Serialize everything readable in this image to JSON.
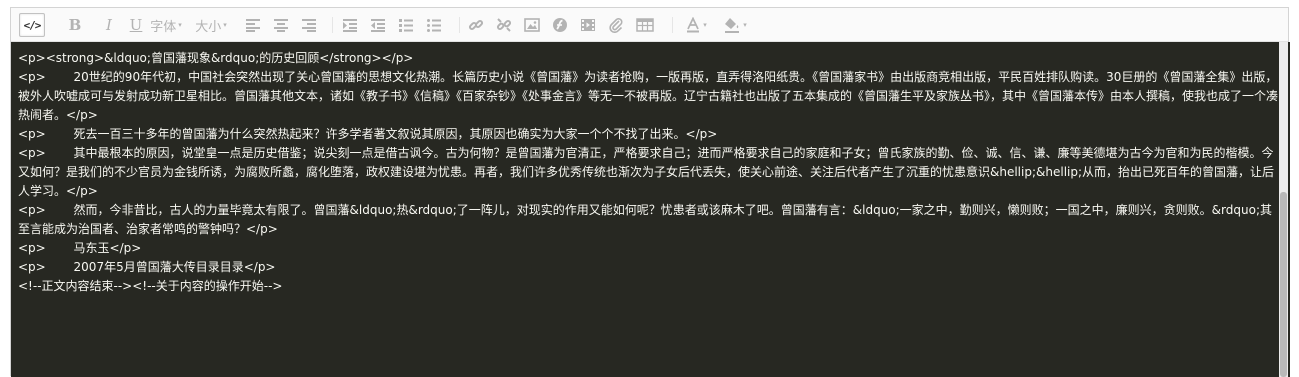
{
  "toolbar": {
    "source_label": "</>",
    "bold_label": "B",
    "italic_label": "I",
    "underline_label": "U",
    "font_family_label": "字体",
    "font_size_label": "大小",
    "caret": "▾",
    "buttons": [
      "code-view",
      "bold",
      "italic",
      "underline",
      "font-family",
      "font-size",
      "align-left",
      "align-center",
      "align-right",
      "indent",
      "outdent",
      "ordered-list",
      "unordered-list",
      "link",
      "unlink",
      "image",
      "flash",
      "video",
      "attachment",
      "table",
      "font-color",
      "background-color"
    ]
  },
  "editor": {
    "lines": [
      "<p><strong>&ldquo;曾国藩现象&rdquo;的历史回顾</strong></p>",
      "<p>　　 20世纪的90年代初，中国社会突然出现了关心曾国藩的思想文化热潮。长篇历史小说《曾国藩》为读者抢购，一版再版，直弄得洛阳纸贵。《曾国藩家书》由出版商竞相出版，平民百姓排队购读。30巨册的《曾国藩全集》出版，被外人吹嘘成可与发射成功新卫星相比。曾国藩其他文本，诸如《教子书》《信稿》《百家杂钞》《处事金言》等无一不被再版。辽宁古籍社也出版了五本集成的《曾国藩生平及家族丛书》，其中《曾国藩本传》由本人撰稿，使我也成了一个凑热闹者。</p>",
      "<p>　　 死去一百三十多年的曾国藩为什么突然热起来？许多学者著文叙说其原因，其原因也确实为大家一个个不找了出来。</p>",
      "<p>　　 其中最根本的原因，说堂皇一点是历史借鉴；说尖刻一点是借古讽今。古为何物？是曾国藩为官清正，严格要求自己；进而严格要求自己的家庭和子女；曾氏家族的勤、俭、诚、信、谦、廉等美德堪为古今为官和为民的楷模。今又如何？是我们的不少官员为金钱所诱，为腐败所蠡，腐化堕落，政权建设堪为忧患。再者，我们许多优秀传统也渐次为子女后代丢失，使关心前途、关注后代者产生了沉重的忧患意识&hellip;&hellip;从而，抬出已死百年的曾国藩，让后人学习。</p>",
      "<p>　　 然而，今非昔比，古人的力量毕竟太有限了。曾国藩&ldquo;热&rdquo;了一阵儿，对现实的作用又能如何呢？忧患者或该麻木了吧。曾国藩有言：&ldquo;一家之中，勤则兴，懒则败；一国之中，廉则兴，贪则败。&rdquo;其至言能成为治国者、治家者常鸣的警钟吗？</p>",
      "<p>　　 马东玉</p>",
      "<p>　　 2007年5月曾国藩大传目录目录</p>",
      "<!--正文内容结束--><!--关于内容的操作开始-->"
    ]
  }
}
